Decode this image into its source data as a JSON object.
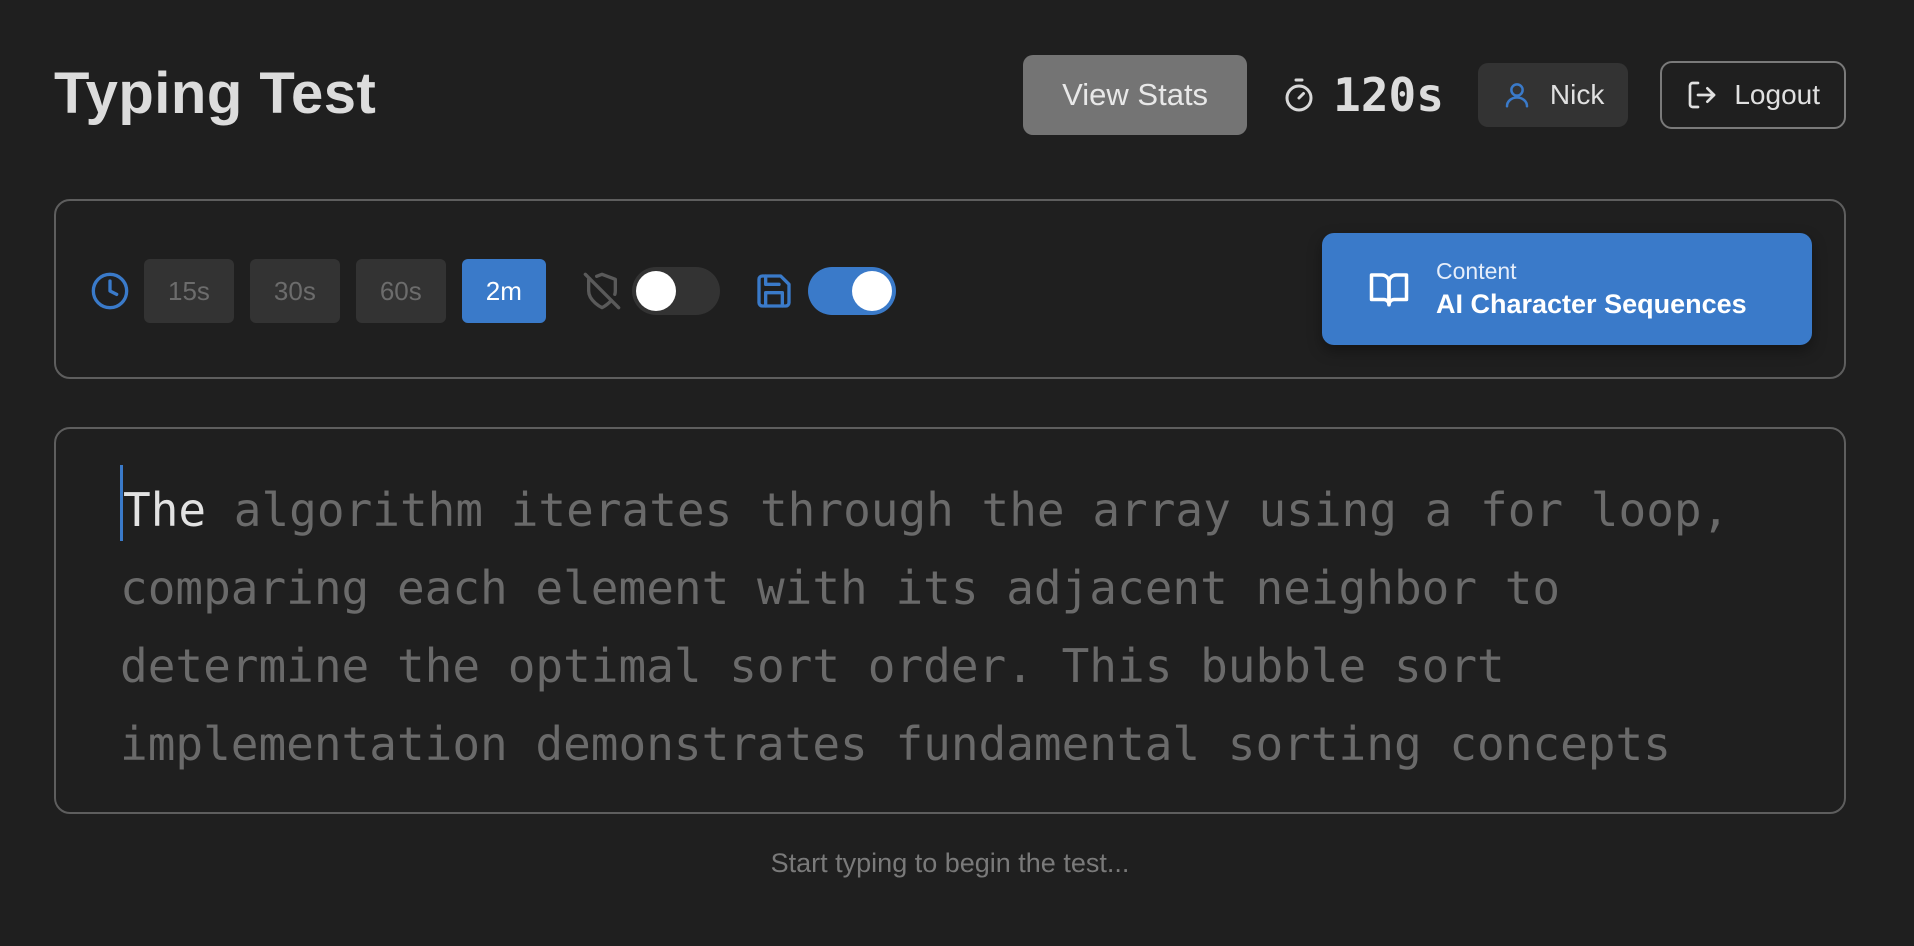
{
  "header": {
    "title": "Typing Test",
    "view_stats_label": "View Stats",
    "timer_value": "120s",
    "user_name": "Nick",
    "logout_label": "Logout"
  },
  "settings": {
    "durations": [
      {
        "label": "15s",
        "active": false
      },
      {
        "label": "30s",
        "active": false
      },
      {
        "label": "60s",
        "active": false
      },
      {
        "label": "2m",
        "active": true
      }
    ],
    "no_backspace_toggle": false,
    "save_toggle": true,
    "content": {
      "label": "Content",
      "value": "AI Character Sequences"
    }
  },
  "typing": {
    "current_word": "The",
    "remaining_text": " algorithm iterates through the array using a for loop, comparing each element with its adjacent neighbor to determine the optimal sort order. This bubble sort implementation demonstrates fundamental sorting concepts"
  },
  "hint": "Start typing to begin the test...",
  "colors": {
    "accent": "#3a7ac9",
    "background": "#1f1f1f",
    "panel_border": "#5e5e5e",
    "untyped_text": "#6a6a6a"
  },
  "icons": {
    "timer": "stopwatch-icon",
    "user": "user-icon",
    "logout": "logout-icon",
    "clock": "clock-icon",
    "shield": "shield-off-icon",
    "save": "save-icon",
    "content": "book-open-icon"
  }
}
